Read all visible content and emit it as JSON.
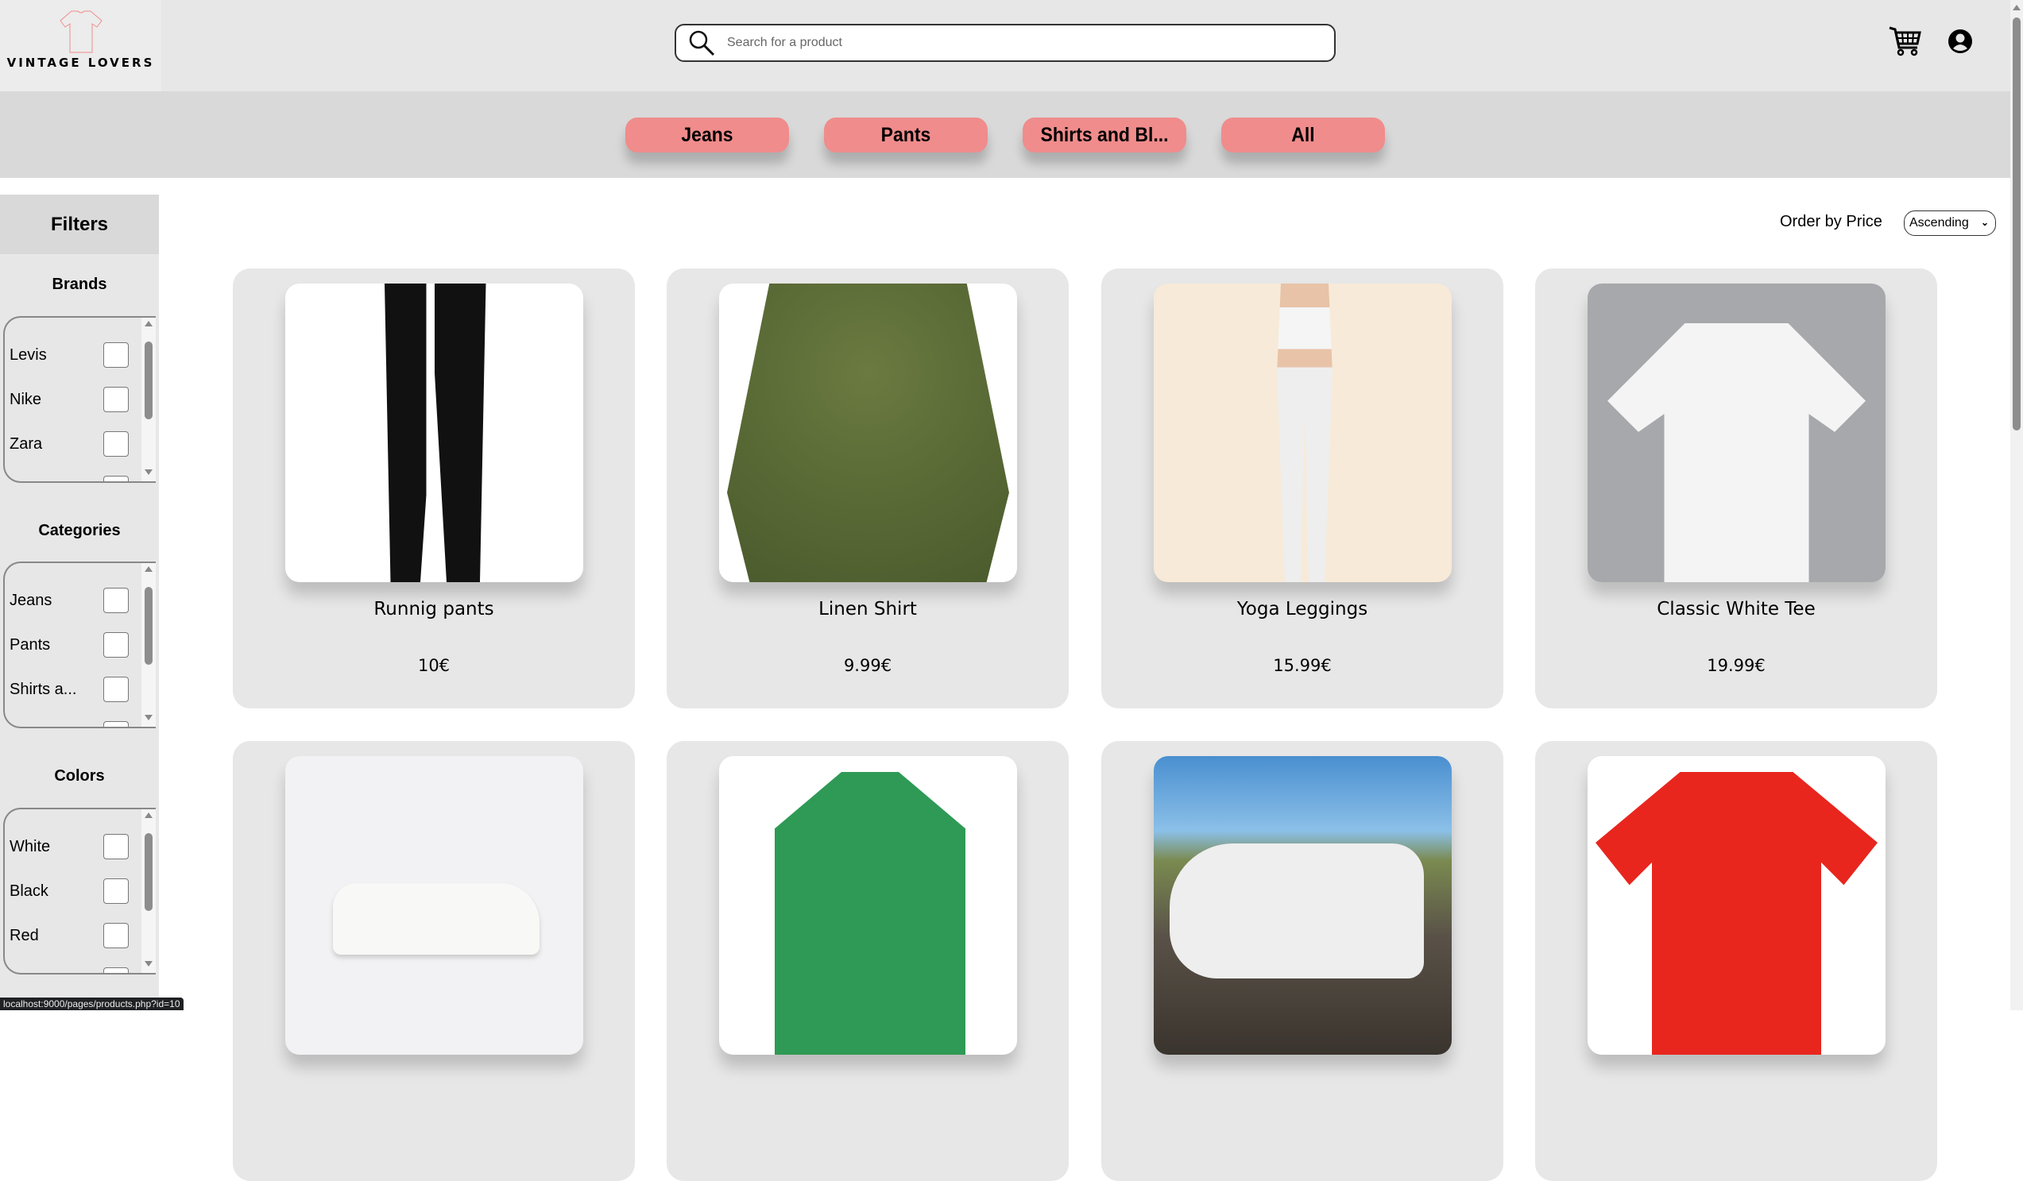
{
  "header": {
    "logo_text": "VINTAGE LOVERS",
    "search_placeholder": "Search for a product",
    "cart_icon": "cart-icon",
    "user_icon": "user-circle-icon"
  },
  "categories": [
    {
      "label": "Jeans"
    },
    {
      "label": "Pants"
    },
    {
      "label": "Shirts and Bl..."
    },
    {
      "label": "All"
    }
  ],
  "sidebar": {
    "title": "Filters",
    "groups": [
      {
        "title": "Brands",
        "items": [
          "Levis",
          "Nike",
          "Zara"
        ]
      },
      {
        "title": "Categories",
        "items": [
          "Jeans",
          "Pants",
          "Shirts a..."
        ]
      },
      {
        "title": "Colors",
        "items": [
          "White",
          "Black",
          "Red"
        ]
      }
    ]
  },
  "sort": {
    "label": "Order by Price",
    "selected": "Ascending"
  },
  "products": [
    {
      "name": "Runnig pants",
      "price": "10€"
    },
    {
      "name": "Linen Shirt",
      "price": "9.99€"
    },
    {
      "name": "Yoga Leggings",
      "price": "15.99€"
    },
    {
      "name": "Classic White Tee",
      "price": "19.99€"
    }
  ],
  "status_url": "localhost:9000/pages/products.php?id=10",
  "colors": {
    "pill": "#f08c8c",
    "header": "#e7e7e7",
    "catbar": "#d9d9d9"
  }
}
